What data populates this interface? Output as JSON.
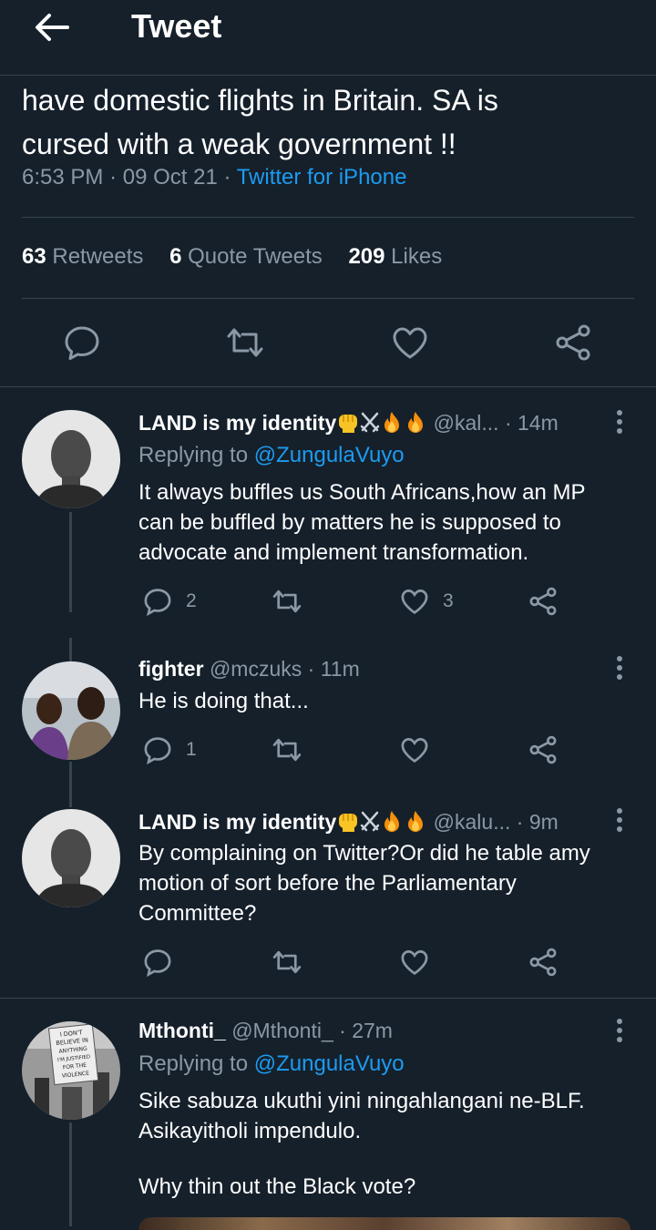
{
  "header": {
    "title": "Tweet"
  },
  "main_tweet": {
    "text_line1": "have domestic flights in Britain. SA is",
    "text_line2": "cursed with a weak government !!",
    "time": "6:53 PM",
    "date": "09 Oct 21",
    "sep": "·",
    "source": "Twitter for iPhone",
    "retweets_count": "63",
    "retweets_label": "Retweets",
    "quotes_count": "6",
    "quotes_label": "Quote Tweets",
    "likes_count": "209",
    "likes_label": "Likes"
  },
  "replies": [
    {
      "name": "LAND is my identity",
      "emoji": [
        "raised-fist",
        "crossed-swords",
        "fire",
        "fire"
      ],
      "handle": "@kal...",
      "time": "· 14m",
      "replying_label": "Replying to",
      "replying_to": "@ZungulaVuyo",
      "lines": [
        "It always buffles us South Africans,how an MP",
        "can be buffled by matters he is supposed to",
        "advocate and implement transformation."
      ],
      "reply_count": "2",
      "retweet_count": "",
      "like_count": "3"
    },
    {
      "name": "fighter",
      "handle": "@mczuks",
      "time": "· 11m",
      "lines": [
        "He is doing that..."
      ],
      "reply_count": "1",
      "retweet_count": "",
      "like_count": ""
    },
    {
      "name": "LAND is my identity",
      "emoji": [
        "raised-fist",
        "crossed-swords",
        "fire",
        "fire"
      ],
      "handle": "@kalu...",
      "time": "· 9m",
      "lines": [
        "By complaining on Twitter?Or did he table amy",
        "motion of sort before the Parliamentary",
        "Committee?"
      ],
      "reply_count": "",
      "retweet_count": "",
      "like_count": ""
    },
    {
      "name": "Mthonti_",
      "handle": "@Mthonti_",
      "time": "· 27m",
      "replying_label": "Replying to",
      "replying_to": "@ZungulaVuyo",
      "lines": [
        "Sike sabuza ukuthi yini ningahlangani ne-BLF.",
        "Asikayitholi impendulo.",
        "",
        "Why thin out the Black vote?"
      ],
      "sign_text": [
        "I DON'T",
        "BELIEVE IN",
        "ANYTHING",
        "I'M JUSTIFIED",
        "FOR THE",
        "VIOLENCE"
      ]
    }
  ],
  "colors": {
    "background": "#15202b",
    "accent": "#1d9bf0",
    "muted": "#8b98a5",
    "divider": "#38444d"
  }
}
